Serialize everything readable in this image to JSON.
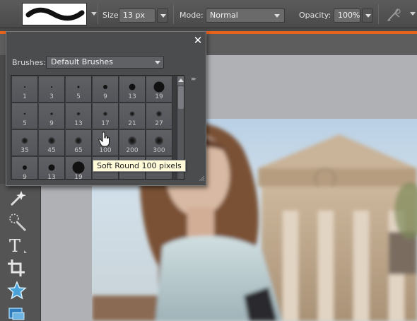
{
  "toolbar": {
    "size_label": "Size:",
    "size_value": "13 px",
    "mode_label": "Mode:",
    "mode_value": "Normal",
    "opacity_label": "Opacity:",
    "opacity_value": "100%",
    "icons": [
      "brush-stroke-preview",
      "chevron-down-icon",
      "tablet-pen-icon"
    ]
  },
  "brush_picker": {
    "close_label": "✕",
    "brushes_label": "Brushes:",
    "brushes_value": "Default Brushes",
    "more_label": "▸▸",
    "brushes": [
      {
        "size": "1",
        "dot": 2,
        "soft": false
      },
      {
        "size": "3",
        "dot": 2,
        "soft": false
      },
      {
        "size": "5",
        "dot": 3,
        "soft": false
      },
      {
        "size": "9",
        "dot": 6,
        "soft": false
      },
      {
        "size": "13",
        "dot": 9,
        "soft": false
      },
      {
        "size": "19",
        "dot": 15,
        "soft": false
      },
      {
        "size": "5",
        "dot": 3,
        "soft": true
      },
      {
        "size": "9",
        "dot": 4,
        "soft": true
      },
      {
        "size": "13",
        "dot": 5,
        "soft": true
      },
      {
        "size": "17",
        "dot": 6,
        "soft": true
      },
      {
        "size": "21",
        "dot": 7,
        "soft": true
      },
      {
        "size": "27",
        "dot": 8,
        "soft": true
      },
      {
        "size": "35",
        "dot": 9,
        "soft": true
      },
      {
        "size": "45",
        "dot": 10,
        "soft": true
      },
      {
        "size": "65",
        "dot": 10,
        "soft": true
      },
      {
        "size": "100",
        "dot": 11,
        "soft": true
      },
      {
        "size": "200",
        "dot": 12,
        "soft": true
      },
      {
        "size": "300",
        "dot": 12,
        "soft": true
      },
      {
        "size": "9",
        "dot": 6,
        "soft": false
      },
      {
        "size": "13",
        "dot": 9,
        "soft": false
      },
      {
        "size": "19",
        "dot": 17,
        "soft": false
      },
      {
        "size": "",
        "dot": 0,
        "soft": false
      },
      {
        "size": "",
        "dot": 0,
        "soft": false
      },
      {
        "size": "",
        "dot": 0,
        "soft": false
      }
    ],
    "tooltip": "Soft Round 100 pixels"
  },
  "tools": [
    "magic-wand-icon",
    "selection-brush-icon",
    "type-tool-icon",
    "crop-tool-icon",
    "custom-shape-star-icon",
    "cookie-cutter-icon"
  ],
  "colors": {
    "accent": "#e8641c",
    "panel": "#4b4c4e",
    "tooltip_bg": "#fffbd9"
  }
}
